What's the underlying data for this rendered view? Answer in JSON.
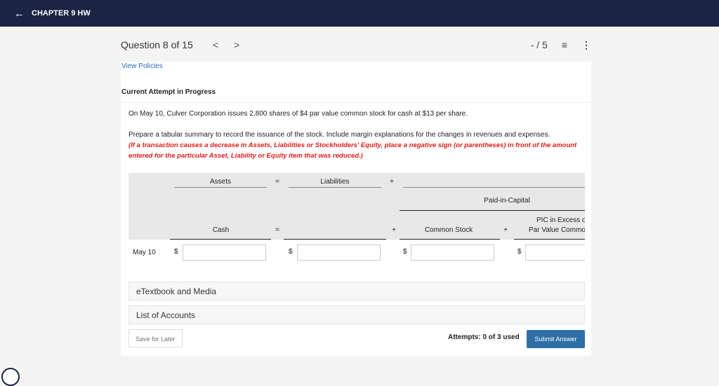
{
  "header": {
    "title": "CHAPTER 9 HW",
    "back_icon": "arrow-left-icon"
  },
  "question": {
    "label": "Question 8 of 15",
    "prev": "<",
    "next": ">",
    "score": "- / 5"
  },
  "view_policies": "View Policies",
  "status": "Current Attempt in Progress",
  "problem": {
    "text": "On May 10, Culver Corporation issues 2,800 shares of $4 par value common stock for cash at $13 per share.",
    "instructions": "Prepare a tabular summary to record the issuance of the stock. Include margin explanations for the changes in revenues and expenses.",
    "note": "(If a transaction causes a decrease in Assets, Liabilities or Stockholders' Equity, place a negative sign (or parentheses) in front of the amount entered for the particular Asset, Liability or Equity item that was reduced.)"
  },
  "table": {
    "assets": "Assets",
    "eq": "=",
    "liabilities": "Liabilities",
    "plus": "+",
    "paid_in_capital": "Paid-in-Capital",
    "cash": "Cash",
    "common_stock": "Common Stock",
    "pic_line1": "PIC in Excess of",
    "pic_line2": "Par Value Common",
    "row_label": "May 10",
    "currency": "$",
    "values": [
      "",
      "",
      "",
      ""
    ]
  },
  "sections": [
    "eTextbook and Media",
    "List of Accounts"
  ],
  "footer": {
    "save": "Save for Later",
    "attempts": "Attempts: 0 of 3 used",
    "submit": "Submit Answer"
  },
  "colors": {
    "header": "#1b2444",
    "submit": "#2f6ea5",
    "note": "#e21b1b"
  }
}
